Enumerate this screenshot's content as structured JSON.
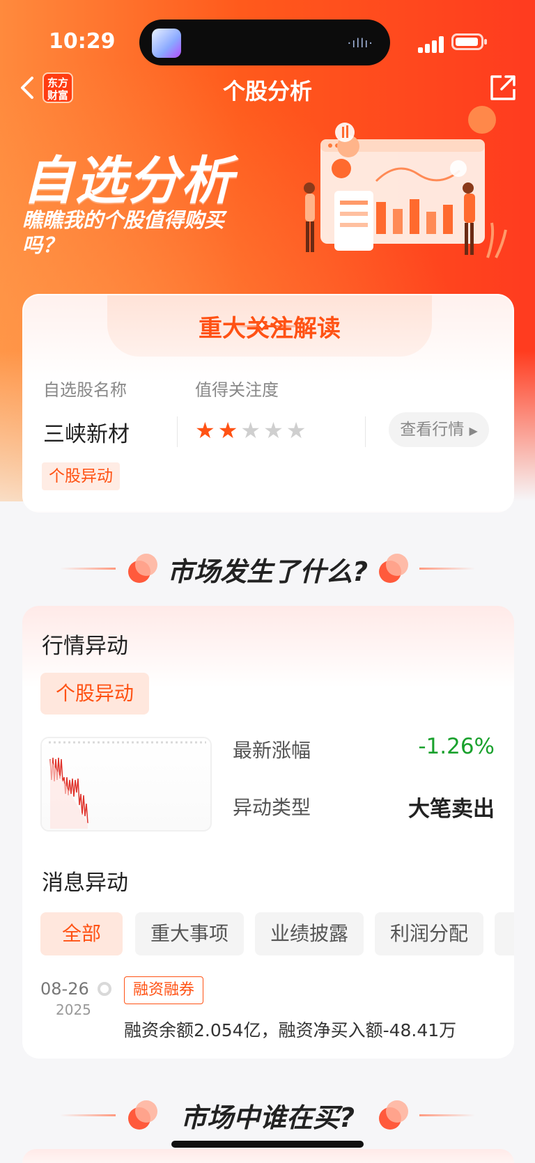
{
  "status_bar": {
    "time": "10:29"
  },
  "nav": {
    "title": "个股分析",
    "logo_text": "东方财富"
  },
  "hero": {
    "title": "自选分析",
    "subtitle": "瞧瞧我的个股值得购买吗？"
  },
  "focus_card": {
    "title": "重大关注解读",
    "col_name_label": "自选股名称",
    "col_attention_label": "值得关注度",
    "stock_name": "三峡新材",
    "attention_stars": 2,
    "attention_max": 5,
    "view_button": "查看行情",
    "tag": "个股异动"
  },
  "section1": {
    "title": "市场发生了什么?"
  },
  "market_card": {
    "heading": "行情异动",
    "tag": "个股异动",
    "latest_change_label": "最新涨幅",
    "latest_change_value": "-1.26%",
    "anomaly_type_label": "异动类型",
    "anomaly_type_value": "大笔卖出",
    "news_heading": "消息异动",
    "filters": [
      "全部",
      "重大事项",
      "业绩披露",
      "利润分配"
    ],
    "news": [
      {
        "date": "08-26",
        "year": "2025",
        "tag": "融资融券",
        "text": "融资余额2.054亿，融资净买入额-48.41万"
      }
    ]
  },
  "section2": {
    "title": "市场中谁在买?"
  },
  "colors": {
    "accent": "#ff5214",
    "down_green": "#1aa12d",
    "star_off": "#cfcfcf"
  }
}
